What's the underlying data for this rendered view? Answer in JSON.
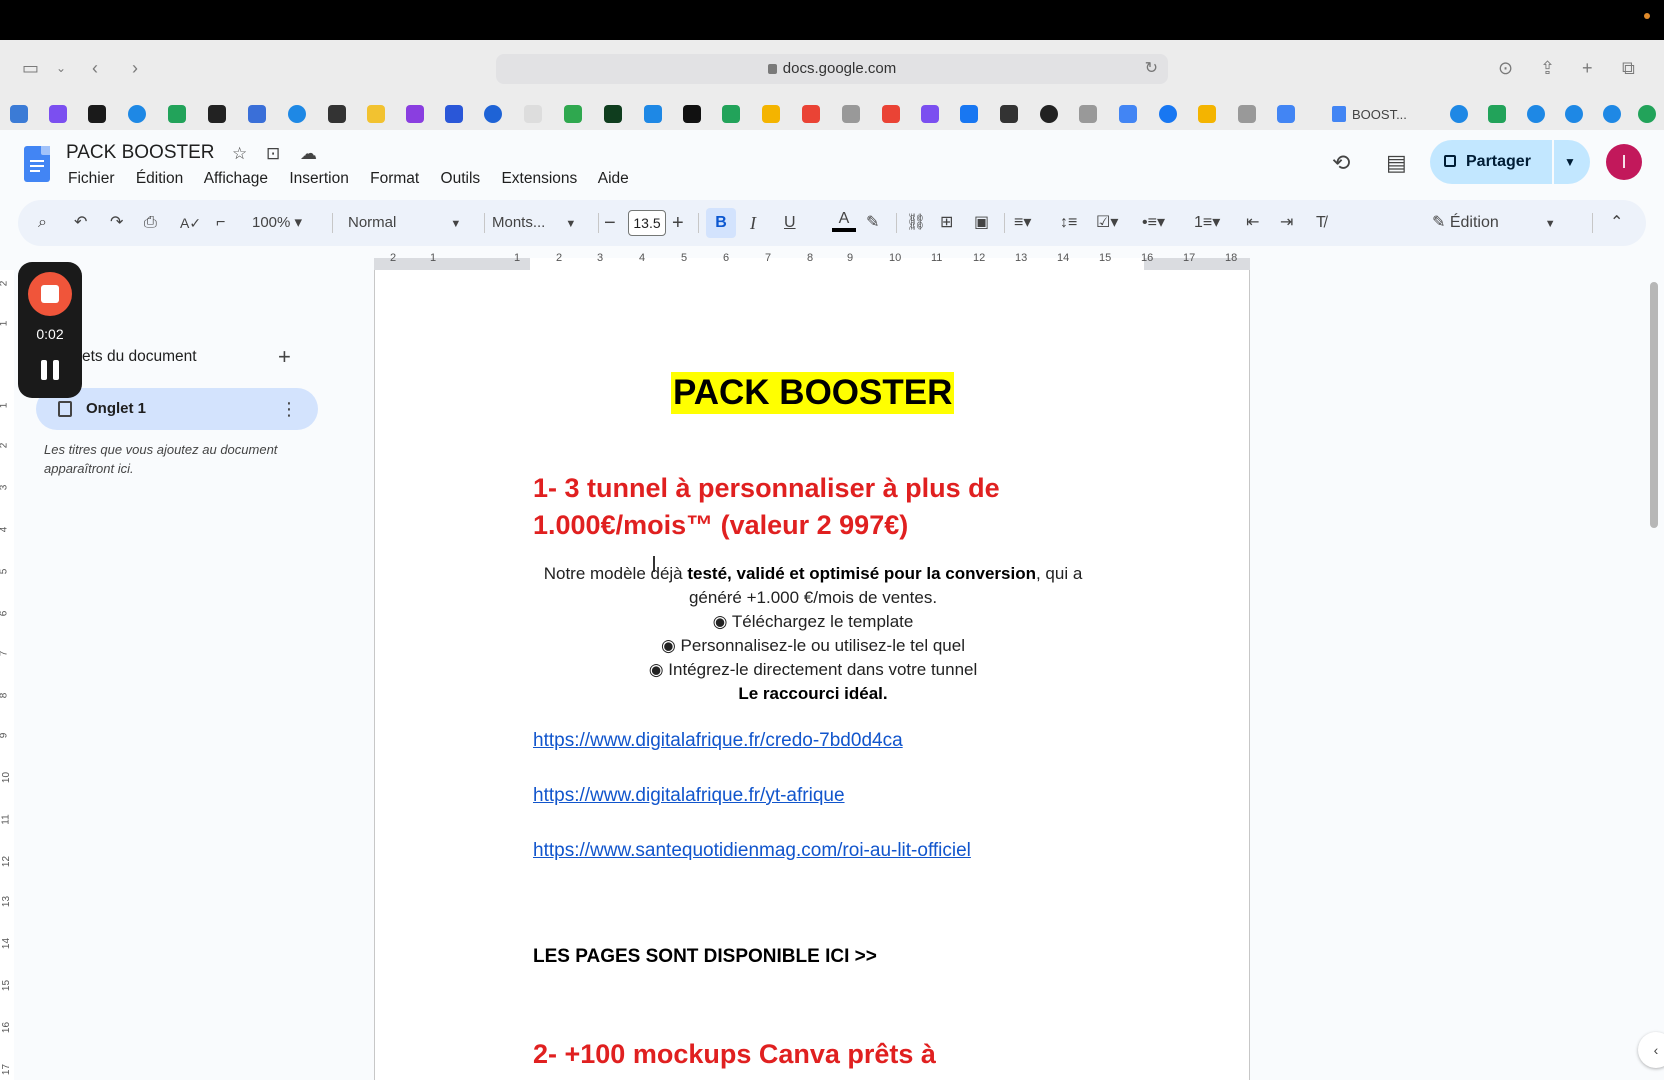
{
  "browser": {
    "address": "docs.google.com",
    "active_bookmark_tab": "BOOST..."
  },
  "doc": {
    "title": "PACK BOOSTER",
    "menu": [
      "Fichier",
      "Édition",
      "Affichage",
      "Insertion",
      "Format",
      "Outils",
      "Extensions",
      "Aide"
    ],
    "share_label": "Partager",
    "avatar_initial": "I"
  },
  "toolbar": {
    "zoom": "100%",
    "style": "Normal",
    "font": "Monts...",
    "font_size": "13.5",
    "bold": "B",
    "italic": "I",
    "underline": "U",
    "text_color": "A",
    "mode": "Édition"
  },
  "ruler": {
    "ticks": [
      "2",
      "1",
      "1",
      "2",
      "3",
      "4",
      "5",
      "6",
      "7",
      "8",
      "9",
      "10",
      "11",
      "12",
      "13",
      "14",
      "15",
      "16",
      "17",
      "18"
    ]
  },
  "vertical_ruler": {
    "ticks": [
      "2",
      "1",
      "1",
      "2",
      "3",
      "4",
      "5",
      "6",
      "7",
      "8",
      "9",
      "10",
      "11",
      "12",
      "13",
      "14",
      "15",
      "16",
      "17"
    ]
  },
  "sidebar": {
    "heading": "ets du document",
    "tab_label": "Onglet 1",
    "hint": "Les titres que vous ajoutez au document apparaîtront ici."
  },
  "recorder": {
    "time": "0:02"
  },
  "content": {
    "title": "PACK BOOSTER",
    "section1_line1": "1- 3 tunnel à personnaliser à plus de",
    "section1_line2": "1.000€/mois™ (valeur 2 997€)",
    "para_pre": "Notre modèle déjà ",
    "para_bold": "testé, validé et optimisé pour la conversion",
    "para_post": ", qui a",
    "para_line2": "généré +1.000 €/mois  de ventes.",
    "bullet1": "◉ Téléchargez le template",
    "bullet2": "◉ Personnalisez-le ou utilisez-le tel quel",
    "bullet3": "◉ Intégrez-le directement dans votre tunnel",
    "tagline": "Le raccourci idéal.",
    "link1": "https://www.digitalafrique.fr/credo-7bd0d4ca",
    "link2": "https://www.digitalafrique.fr/yt-afrique",
    "link3": "https://www.santequotidienmag.com/roi-au-lit-officiel",
    "pages_note": "LES PAGES SONT DISPONIBLE ICI >>",
    "section2_line1": "2- +100 mockups Canva prêts à"
  },
  "colors": {
    "heading_red": "#e02020",
    "highlight_yellow": "#ffff00",
    "link_blue": "#1155cc",
    "share_bg": "#c2e7ff",
    "accent_blue": "#4285f4",
    "avatar": "#c2185b",
    "recorder_stop": "#f0553a"
  },
  "icons": [
    "sidebar-toggle-icon",
    "back-icon",
    "forward-icon",
    "lock-icon",
    "reload-icon",
    "download-icon",
    "share-icon",
    "new-tab-icon",
    "tabs-overview-icon",
    "star-icon",
    "move-folder-icon",
    "cloud-saved-icon",
    "history-icon",
    "comments-icon",
    "search-icon",
    "undo-icon",
    "redo-icon",
    "print-icon",
    "spellcheck-icon",
    "paint-format-icon",
    "highlighter-icon",
    "link-icon",
    "add-comment-icon",
    "image-icon",
    "align-icon",
    "line-spacing-icon",
    "checklist-icon",
    "bullet-list-icon",
    "numbered-list-icon",
    "indent-decrease-icon",
    "indent-increase-icon",
    "clear-format-icon",
    "pencil-icon",
    "collapse-icon"
  ]
}
